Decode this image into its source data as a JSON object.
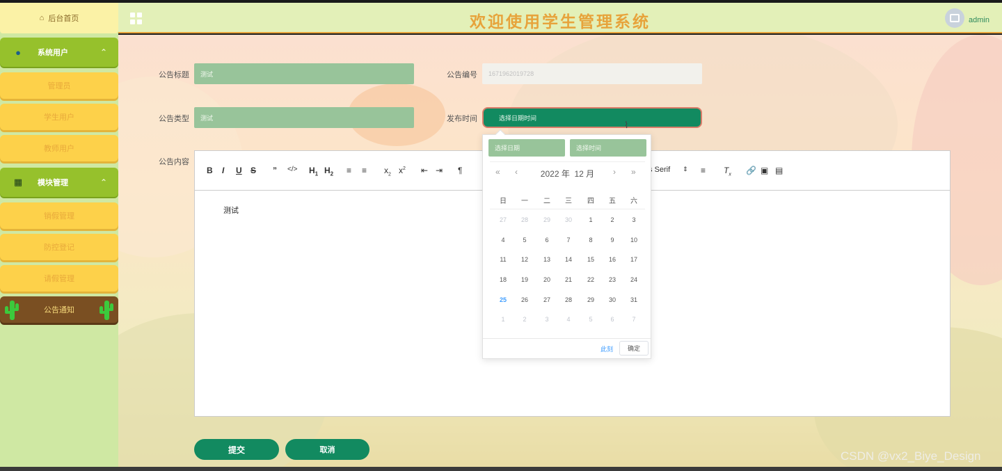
{
  "sidebar": {
    "home_label": "后台首页",
    "groups": [
      {
        "label": "系统用户",
        "icon": "user-icon",
        "items": [
          "管理员",
          "学生用户",
          "教师用户"
        ]
      },
      {
        "label": "模块管理",
        "icon": "grid-icon",
        "items": [
          "销假管理",
          "防控登记",
          "请假管理",
          "公告通知"
        ]
      }
    ],
    "active_item": "公告通知"
  },
  "header": {
    "title": "欢迎使用学生管理系统",
    "user": "admin"
  },
  "form": {
    "title_label": "公告标题",
    "title_value": "测试",
    "number_label": "公告编号",
    "number_value": "1671962019728",
    "type_label": "公告类型",
    "type_value": "测试",
    "time_label": "发布时间",
    "time_placeholder": "选择日期时间",
    "content_label": "公告内容",
    "content_value": "测试"
  },
  "editor": {
    "font_family_partial": "s Serif"
  },
  "datepicker": {
    "date_placeholder": "选择日期",
    "time_placeholder": "选择时间",
    "year_label": "2022 年",
    "month_label": "12 月",
    "weekdays": [
      "日",
      "一",
      "二",
      "三",
      "四",
      "五",
      "六"
    ],
    "weeks": [
      [
        27,
        28,
        29,
        30,
        1,
        2,
        3
      ],
      [
        4,
        5,
        6,
        7,
        8,
        9,
        10
      ],
      [
        11,
        12,
        13,
        14,
        15,
        16,
        17
      ],
      [
        18,
        19,
        20,
        21,
        22,
        23,
        24
      ],
      [
        25,
        26,
        27,
        28,
        29,
        30,
        31
      ],
      [
        1,
        2,
        3,
        4,
        5,
        6,
        7
      ]
    ],
    "today": 25,
    "now_label": "此刻",
    "ok_label": "确定"
  },
  "actions": {
    "submit_label": "提交",
    "cancel_label": "取消"
  },
  "watermark": "CSDN @vx2_Biye_Design",
  "colors": {
    "primary_green": "#128a60",
    "menu_green": "#96c12c",
    "menu_yellow": "#fdd14a",
    "title_orange": "#e7a33b",
    "active_brown": "#7a4f22"
  }
}
